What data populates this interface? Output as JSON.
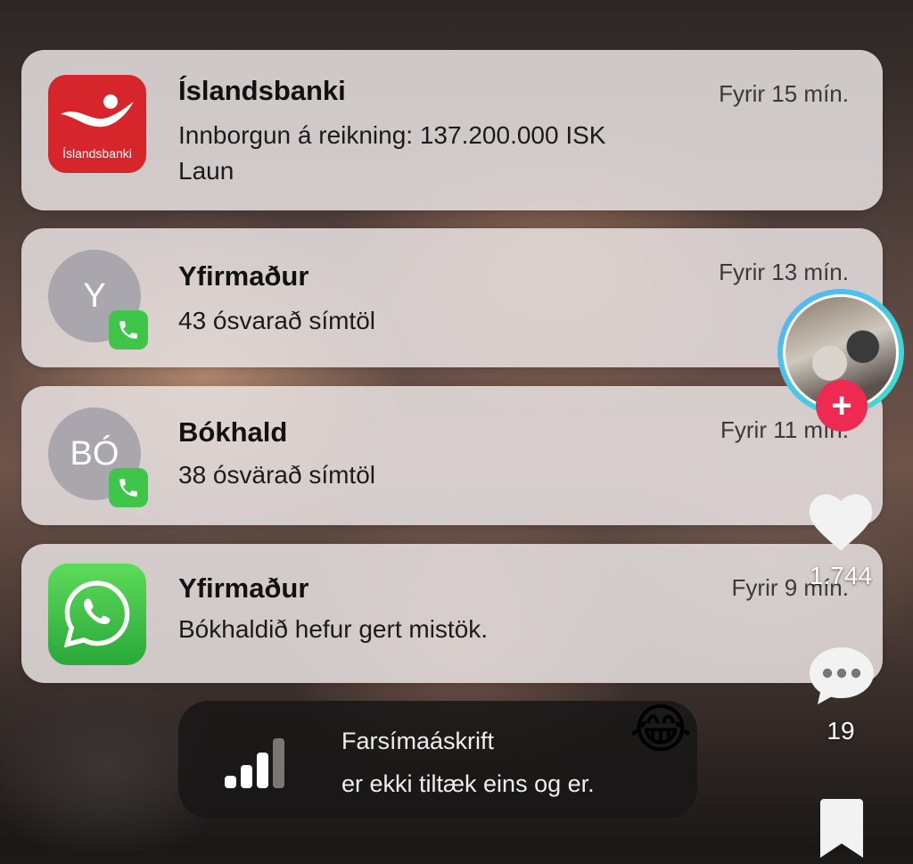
{
  "notifications": [
    {
      "app_logo_text": "Íslandsbanki",
      "title": "Íslandsbanki",
      "line1": "Innborgun á reikning: 137.200.000 ISK",
      "line2": "Laun",
      "time": "Fyrir 15 mín."
    },
    {
      "avatar_letters": "Y",
      "title": "Yfirmaður",
      "line1": "43 ósvarað símtöl",
      "time": "Fyrir 13 mín."
    },
    {
      "avatar_letters": "BÓ",
      "title": "Bókhald",
      "line1": "38 ósvärað símtöl",
      "time": "Fyrir 11 mín."
    },
    {
      "title": "Yfirmaður",
      "line1": "Bókhaldið hefur gert mistök.",
      "time": "Fyrir 9 mín."
    }
  ],
  "toast": {
    "line1": "Farsímaáskrift",
    "line2": "er ekki tiltæk eins og er.",
    "emoji": "😂"
  },
  "sidebar": {
    "likes": "1.744",
    "comments": "19",
    "follow_symbol": "+"
  },
  "colors": {
    "bank_red": "#d6262b",
    "phone_green": "#3fc64a",
    "follow_red": "#ee2a53",
    "whatsapp_green": "#2aa83a"
  }
}
